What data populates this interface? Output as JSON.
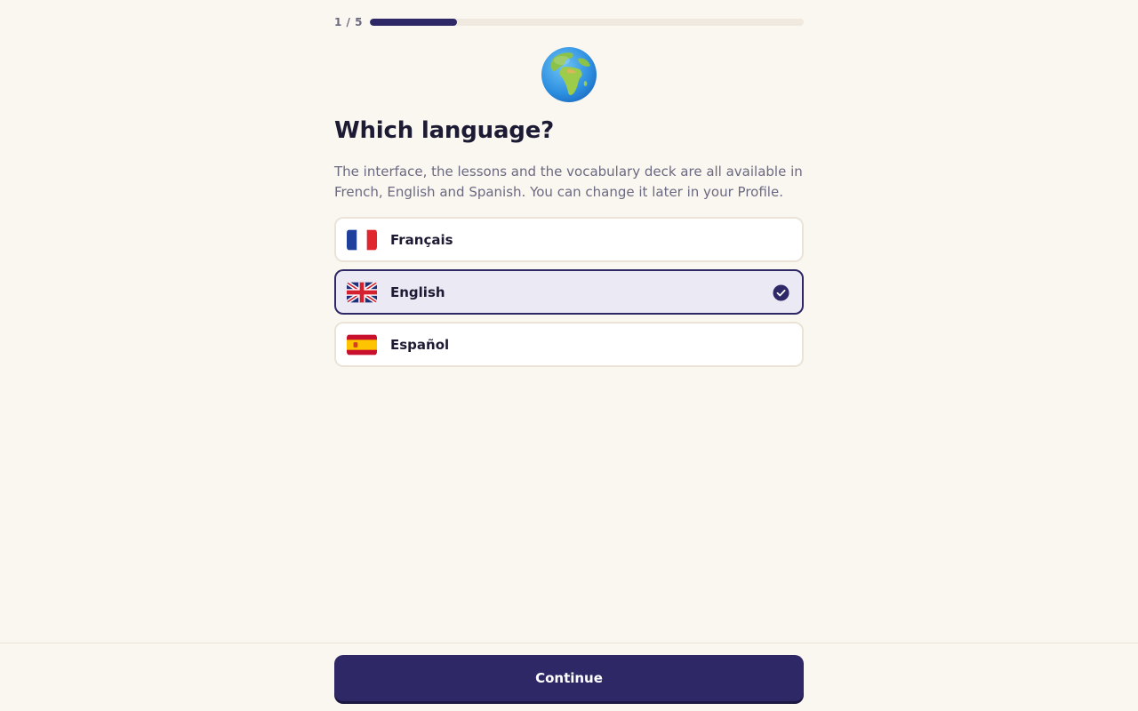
{
  "progress": {
    "step_label": "1 / 5",
    "current": 1,
    "total": 5,
    "fraction": 0.2
  },
  "header": {
    "icon": "globe-africa-icon",
    "title": "Which language?",
    "subtitle": "The interface, the lessons and the vocabulary deck are all available in French, English and Spanish. You can change it later in your Profile."
  },
  "options": [
    {
      "label": "Français",
      "flag": "france-flag-icon",
      "selected": false
    },
    {
      "label": "English",
      "flag": "uk-flag-icon",
      "selected": true
    },
    {
      "label": "Español",
      "flag": "spain-flag-icon",
      "selected": false
    }
  ],
  "footer": {
    "continue_label": "Continue"
  },
  "colors": {
    "background": "#faf7f1",
    "accent": "#2e2966",
    "selected_bg": "#ebe9f3",
    "border": "#ece3d8",
    "text": "#1d1b33",
    "muted": "#6b6980"
  }
}
